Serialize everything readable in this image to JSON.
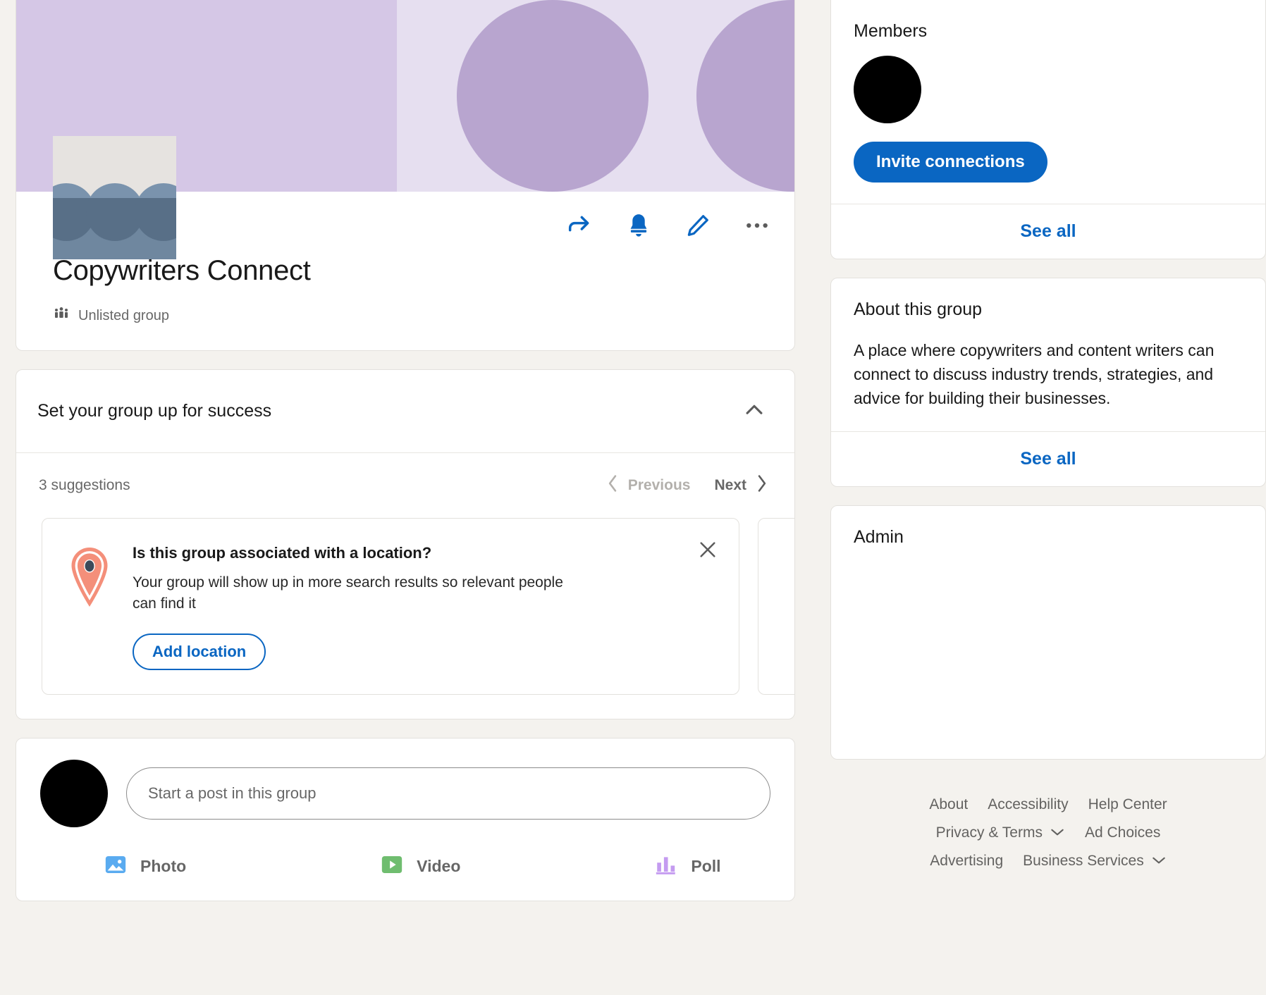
{
  "group": {
    "title": "Copywriters Connect",
    "visibility": "Unlisted group",
    "actions": {
      "share": "share-icon",
      "notify": "bell-icon",
      "edit": "pencil-icon",
      "more": "more-options-icon"
    },
    "banner_colors": {
      "left": "#d5c7e6",
      "right": "#e6dff0",
      "circle": "#b8a5cf"
    }
  },
  "suggestions": {
    "heading": "Set your group up for success",
    "count_label": "3 suggestions",
    "previous_label": "Previous",
    "next_label": "Next",
    "items": [
      {
        "title": "Is this group associated with a location?",
        "description": "Your group will show up in more search results so relevant people can find it",
        "cta": "Add location",
        "icon": "location-pin-icon"
      }
    ]
  },
  "composer": {
    "placeholder": "Start a post in this group",
    "value": "",
    "actions": [
      {
        "label": "Photo",
        "icon": "photo-icon",
        "color": "#5aabf0"
      },
      {
        "label": "Video",
        "icon": "video-icon",
        "color": "#6fbd6f"
      },
      {
        "label": "Poll",
        "icon": "poll-icon",
        "color": "#c49bf0"
      }
    ]
  },
  "sidebar": {
    "members": {
      "title": "Members",
      "invite_label": "Invite connections",
      "see_all": "See all"
    },
    "about": {
      "title": "About this group",
      "body": "A place where copywriters and content writers can connect to discuss industry trends, strategies, and advice for building their businesses.",
      "see_all": "See all"
    },
    "admin": {
      "title": "Admin"
    }
  },
  "footer": {
    "row1": [
      "About",
      "Accessibility",
      "Help Center"
    ],
    "row2": [
      "Privacy & Terms",
      "Ad Choices"
    ],
    "row3": [
      "Advertising",
      "Business Services"
    ]
  },
  "colors": {
    "accent": "#0a66c2",
    "page_bg": "#f4f2ee",
    "pin": "#f48f7a"
  }
}
